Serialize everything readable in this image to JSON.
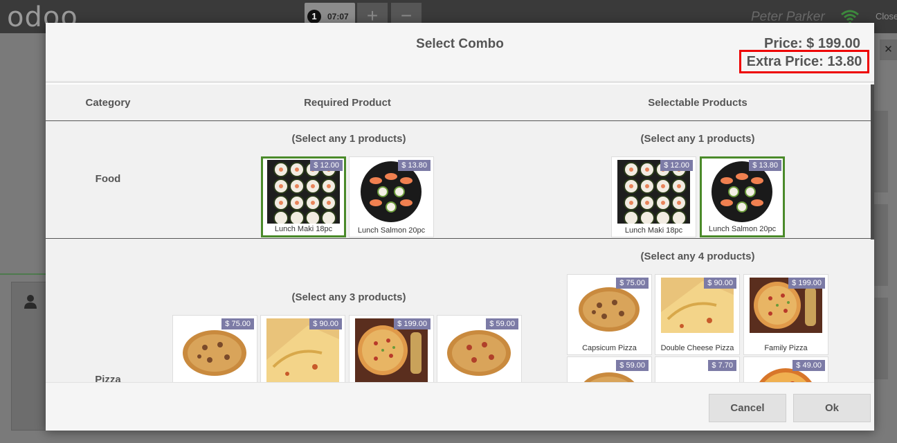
{
  "pos": {
    "logo": "odoo",
    "order_number": "1",
    "order_time": "07:07",
    "add_label": "+",
    "remove_label": "−",
    "user": "Peter Parker",
    "close_label": "Close"
  },
  "modal": {
    "title": "Select Combo",
    "price": "Price: $ 199.00",
    "extra_price": "Extra Price: 13.80",
    "headers": {
      "category": "Category",
      "required": "Required Product",
      "selectable": "Selectable Products"
    },
    "rows": [
      {
        "category": "Food",
        "required_hint": "(Select any 1 products)",
        "selectable_hint": "(Select any 1 products)",
        "required": [
          {
            "name": "Lunch Maki 18pc",
            "price": "$ 12.00",
            "selected": true
          },
          {
            "name": "Lunch Salmon 20pc",
            "price": "$ 13.80",
            "selected": false
          }
        ],
        "selectable": [
          {
            "name": "Lunch Maki 18pc",
            "price": "$ 12.00",
            "selected": false
          },
          {
            "name": "Lunch Salmon 20pc",
            "price": "$ 13.80",
            "selected": true
          }
        ]
      },
      {
        "category": "Pizza",
        "required_hint": "(Select any 3 products)",
        "selectable_hint": "(Select any 4 products)",
        "required": [
          {
            "name": "",
            "price": "$ 75.00"
          },
          {
            "name": "",
            "price": "$ 90.00"
          },
          {
            "name": "",
            "price": "$ 199.00"
          },
          {
            "name": "",
            "price": "$ 59.00"
          }
        ],
        "selectable": [
          {
            "name": "Capsicum Pizza",
            "price": "$ 75.00"
          },
          {
            "name": "Double Cheese Pizza",
            "price": "$ 90.00"
          },
          {
            "name": "Family Pizza",
            "price": "$ 199.00"
          },
          {
            "name": "",
            "price": "$ 59.00"
          },
          {
            "name": "",
            "price": "$ 7.70"
          },
          {
            "name": "",
            "price": "$ 49.00"
          }
        ]
      }
    ],
    "cancel_label": "Cancel",
    "ok_label": "Ok"
  },
  "colors": {
    "selected_border": "#4a8a2a",
    "price_tag": "#7c7ba6",
    "highlight": "#ee0000"
  }
}
